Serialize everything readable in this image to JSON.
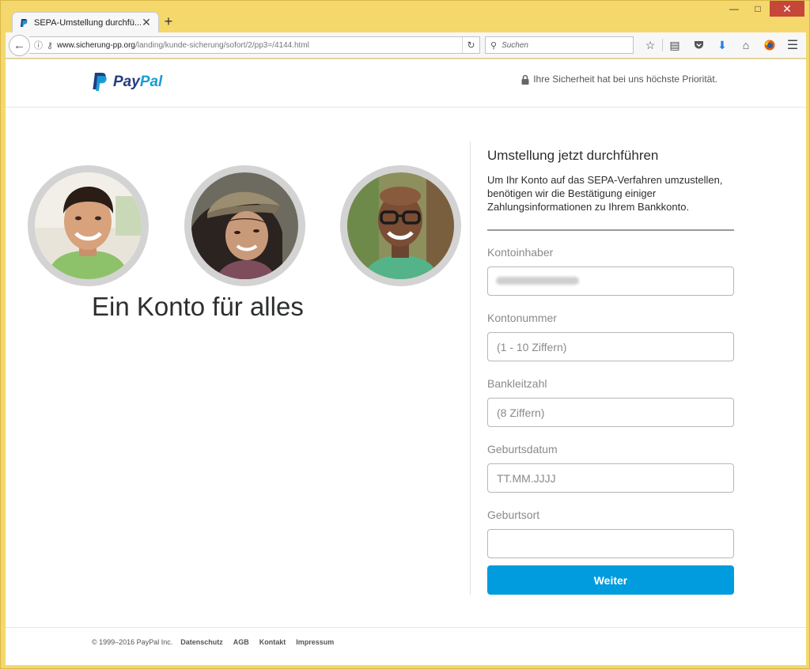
{
  "browser": {
    "tab_title": "SEPA-Umstellung durchfü...",
    "url_host": "www.sicherung-pp.org",
    "url_path": "/landing/kunde-sicherung/sofort/2/pp3=/4144.html",
    "search_placeholder": "Suchen",
    "icons": [
      "back-arrow-icon",
      "info-icon",
      "key-icon",
      "reload-icon",
      "search-icon",
      "star-icon",
      "reader-icon",
      "pocket-icon",
      "download-icon",
      "home-icon",
      "firefox-icon",
      "menu-icon"
    ]
  },
  "header": {
    "brand_left": "Pay",
    "brand_right": "Pal",
    "security_note": "Ihre Sicherheit hat bei uns höchste Priorität."
  },
  "hero": {
    "headline": "Ein Konto für alles"
  },
  "form": {
    "title": "Umstellung jetzt durchführen",
    "description": "Um Ihr Konto auf das SEPA-Verfahren umzustellen, benötigen wir die Bestätigung einiger Zahlungsinformationen zu Ihrem Bankkonto.",
    "fields": [
      {
        "label": "Kontoinhaber",
        "placeholder": ""
      },
      {
        "label": "Kontonummer",
        "placeholder": "(1 - 10 Ziffern)"
      },
      {
        "label": "Bankleitzahl",
        "placeholder": "(8 Ziffern)"
      },
      {
        "label": "Geburtsdatum",
        "placeholder": "TT.MM.JJJJ"
      },
      {
        "label": "Geburtsort",
        "placeholder": ""
      }
    ],
    "submit_label": "Weiter"
  },
  "footer": {
    "copyright": "© 1999–2016 PayPal Inc.",
    "links": [
      "Datenschutz",
      "AGB",
      "Kontakt",
      "Impressum"
    ]
  },
  "colors": {
    "window_frame": "#f4d86c",
    "paypal_dark": "#253b80",
    "paypal_light": "#179bd7",
    "button": "#009cde",
    "close_button": "#c7463a"
  }
}
